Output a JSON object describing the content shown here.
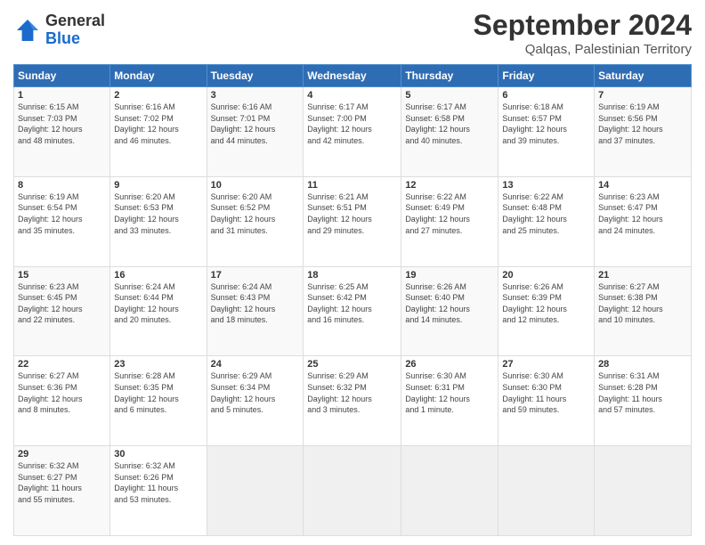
{
  "header": {
    "logo_general": "General",
    "logo_blue": "Blue",
    "main_title": "September 2024",
    "subtitle": "Qalqas, Palestinian Territory"
  },
  "days_of_week": [
    "Sunday",
    "Monday",
    "Tuesday",
    "Wednesday",
    "Thursday",
    "Friday",
    "Saturday"
  ],
  "weeks": [
    [
      {
        "day": "1",
        "info": "Sunrise: 6:15 AM\nSunset: 7:03 PM\nDaylight: 12 hours\nand 48 minutes."
      },
      {
        "day": "2",
        "info": "Sunrise: 6:16 AM\nSunset: 7:02 PM\nDaylight: 12 hours\nand 46 minutes."
      },
      {
        "day": "3",
        "info": "Sunrise: 6:16 AM\nSunset: 7:01 PM\nDaylight: 12 hours\nand 44 minutes."
      },
      {
        "day": "4",
        "info": "Sunrise: 6:17 AM\nSunset: 7:00 PM\nDaylight: 12 hours\nand 42 minutes."
      },
      {
        "day": "5",
        "info": "Sunrise: 6:17 AM\nSunset: 6:58 PM\nDaylight: 12 hours\nand 40 minutes."
      },
      {
        "day": "6",
        "info": "Sunrise: 6:18 AM\nSunset: 6:57 PM\nDaylight: 12 hours\nand 39 minutes."
      },
      {
        "day": "7",
        "info": "Sunrise: 6:19 AM\nSunset: 6:56 PM\nDaylight: 12 hours\nand 37 minutes."
      }
    ],
    [
      {
        "day": "8",
        "info": "Sunrise: 6:19 AM\nSunset: 6:54 PM\nDaylight: 12 hours\nand 35 minutes."
      },
      {
        "day": "9",
        "info": "Sunrise: 6:20 AM\nSunset: 6:53 PM\nDaylight: 12 hours\nand 33 minutes."
      },
      {
        "day": "10",
        "info": "Sunrise: 6:20 AM\nSunset: 6:52 PM\nDaylight: 12 hours\nand 31 minutes."
      },
      {
        "day": "11",
        "info": "Sunrise: 6:21 AM\nSunset: 6:51 PM\nDaylight: 12 hours\nand 29 minutes."
      },
      {
        "day": "12",
        "info": "Sunrise: 6:22 AM\nSunset: 6:49 PM\nDaylight: 12 hours\nand 27 minutes."
      },
      {
        "day": "13",
        "info": "Sunrise: 6:22 AM\nSunset: 6:48 PM\nDaylight: 12 hours\nand 25 minutes."
      },
      {
        "day": "14",
        "info": "Sunrise: 6:23 AM\nSunset: 6:47 PM\nDaylight: 12 hours\nand 24 minutes."
      }
    ],
    [
      {
        "day": "15",
        "info": "Sunrise: 6:23 AM\nSunset: 6:45 PM\nDaylight: 12 hours\nand 22 minutes."
      },
      {
        "day": "16",
        "info": "Sunrise: 6:24 AM\nSunset: 6:44 PM\nDaylight: 12 hours\nand 20 minutes."
      },
      {
        "day": "17",
        "info": "Sunrise: 6:24 AM\nSunset: 6:43 PM\nDaylight: 12 hours\nand 18 minutes."
      },
      {
        "day": "18",
        "info": "Sunrise: 6:25 AM\nSunset: 6:42 PM\nDaylight: 12 hours\nand 16 minutes."
      },
      {
        "day": "19",
        "info": "Sunrise: 6:26 AM\nSunset: 6:40 PM\nDaylight: 12 hours\nand 14 minutes."
      },
      {
        "day": "20",
        "info": "Sunrise: 6:26 AM\nSunset: 6:39 PM\nDaylight: 12 hours\nand 12 minutes."
      },
      {
        "day": "21",
        "info": "Sunrise: 6:27 AM\nSunset: 6:38 PM\nDaylight: 12 hours\nand 10 minutes."
      }
    ],
    [
      {
        "day": "22",
        "info": "Sunrise: 6:27 AM\nSunset: 6:36 PM\nDaylight: 12 hours\nand 8 minutes."
      },
      {
        "day": "23",
        "info": "Sunrise: 6:28 AM\nSunset: 6:35 PM\nDaylight: 12 hours\nand 6 minutes."
      },
      {
        "day": "24",
        "info": "Sunrise: 6:29 AM\nSunset: 6:34 PM\nDaylight: 12 hours\nand 5 minutes."
      },
      {
        "day": "25",
        "info": "Sunrise: 6:29 AM\nSunset: 6:32 PM\nDaylight: 12 hours\nand 3 minutes."
      },
      {
        "day": "26",
        "info": "Sunrise: 6:30 AM\nSunset: 6:31 PM\nDaylight: 12 hours\nand 1 minute."
      },
      {
        "day": "27",
        "info": "Sunrise: 6:30 AM\nSunset: 6:30 PM\nDaylight: 11 hours\nand 59 minutes."
      },
      {
        "day": "28",
        "info": "Sunrise: 6:31 AM\nSunset: 6:28 PM\nDaylight: 11 hours\nand 57 minutes."
      }
    ],
    [
      {
        "day": "29",
        "info": "Sunrise: 6:32 AM\nSunset: 6:27 PM\nDaylight: 11 hours\nand 55 minutes."
      },
      {
        "day": "30",
        "info": "Sunrise: 6:32 AM\nSunset: 6:26 PM\nDaylight: 11 hours\nand 53 minutes."
      },
      {
        "day": "",
        "info": ""
      },
      {
        "day": "",
        "info": ""
      },
      {
        "day": "",
        "info": ""
      },
      {
        "day": "",
        "info": ""
      },
      {
        "day": "",
        "info": ""
      }
    ]
  ]
}
